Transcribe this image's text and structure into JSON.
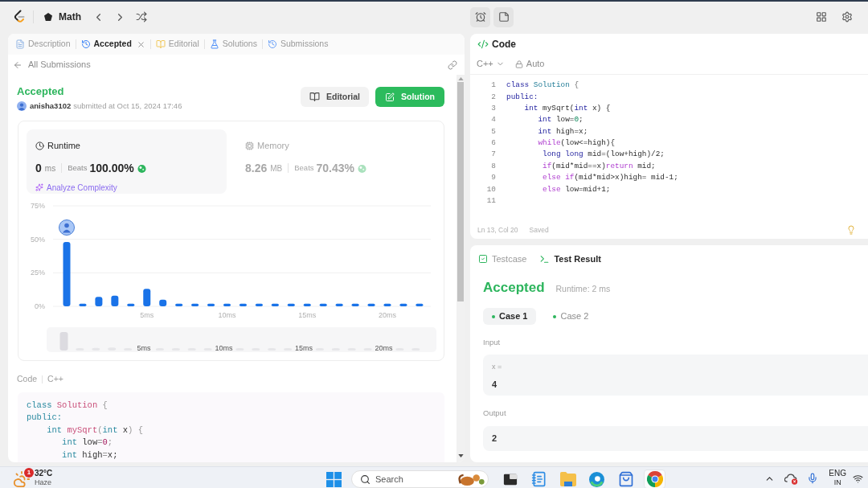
{
  "topbar": {
    "problem_list": "Math"
  },
  "left_panel": {
    "tabs": [
      {
        "label": "Description",
        "kind": "description",
        "selected": false,
        "closable": false
      },
      {
        "label": "Accepted",
        "kind": "accepted",
        "selected": true,
        "closable": true
      },
      {
        "label": "Editorial",
        "kind": "editorial",
        "selected": false,
        "closable": false
      },
      {
        "label": "Solutions",
        "kind": "solutions",
        "selected": false,
        "closable": false
      },
      {
        "label": "Submissions",
        "kind": "submissions",
        "selected": false,
        "closable": false
      }
    ],
    "back_link": "All Submissions",
    "submission": {
      "status": "Accepted",
      "user": "anisha3102",
      "submitted": "submitted at Oct 15, 2024 17:46"
    },
    "buttons": [
      {
        "label": "Editorial",
        "kind": "secondary"
      },
      {
        "label": "Solution",
        "kind": "primary"
      }
    ],
    "metrics": [
      {
        "kind": "runtime",
        "label": "Runtime",
        "value": "0",
        "unit": "ms",
        "beats_label": "Beats",
        "beats": "100.00%",
        "selected": true,
        "link": "Analyze Complexity"
      },
      {
        "kind": "memory",
        "label": "Memory",
        "value": "8.26",
        "unit": "MB",
        "beats_label": "Beats",
        "beats": "70.43%",
        "selected": false
      }
    ],
    "chart_data": {
      "type": "bar",
      "categories": [
        null,
        null,
        null,
        null,
        null,
        "5ms",
        null,
        null,
        null,
        null,
        "10ms",
        null,
        null,
        null,
        null,
        "15ms",
        null,
        null,
        null,
        null,
        "20ms",
        null,
        null
      ],
      "values": [
        48,
        2,
        7,
        8,
        2,
        13,
        5,
        2,
        2,
        2,
        2,
        2,
        2,
        2,
        2,
        2,
        2,
        2,
        2,
        2,
        2,
        2,
        2
      ],
      "ylim": [
        0,
        75
      ],
      "yticks": [
        {
          "value": 0,
          "label": "0%"
        },
        {
          "value": 25,
          "label": "25%"
        },
        {
          "value": 50,
          "label": "50%"
        },
        {
          "value": 75,
          "label": "75%"
        }
      ]
    },
    "overview_labels": [
      "5ms",
      "10ms",
      "15ms",
      "20ms"
    ],
    "code_header": {
      "title": "Code",
      "language": "C++"
    },
    "code": [
      {
        "tokens": [
          {
            "text": "class",
            "kind": "keyword"
          },
          {
            "text": " Solution",
            "kind": "type"
          },
          {
            "text": " {",
            "kind": "punct"
          }
        ]
      },
      {
        "tokens": [
          {
            "text": "public:",
            "kind": "keyword"
          }
        ]
      },
      {
        "tokens": [
          {
            "text": "    int",
            "kind": "keyword"
          },
          {
            "text": " mySqrt",
            "kind": "type"
          },
          {
            "text": "(",
            "kind": "punct"
          },
          {
            "text": "int",
            "kind": "keyword"
          },
          {
            "text": " x",
            "kind": "plain"
          },
          {
            "text": ") {",
            "kind": "punct"
          }
        ]
      },
      {
        "tokens": [
          {
            "text": "       int",
            "kind": "keyword"
          },
          {
            "text": " low",
            "kind": "plain"
          },
          {
            "text": "=",
            "kind": "punct"
          },
          {
            "text": "0",
            "kind": "number"
          },
          {
            "text": ";",
            "kind": "punct"
          }
        ]
      },
      {
        "tokens": [
          {
            "text": "       int",
            "kind": "keyword"
          },
          {
            "text": " high",
            "kind": "plain"
          },
          {
            "text": "=",
            "kind": "punct"
          },
          {
            "text": "x;",
            "kind": "plain"
          }
        ]
      }
    ]
  },
  "editor": {
    "title": "Code",
    "language": "C++",
    "mode": "Auto",
    "lines": [
      {
        "number": "1",
        "tokens": [
          {
            "text": "class",
            "kind": "keyword"
          },
          {
            "text": " Solution",
            "kind": "type"
          },
          {
            "text": " {",
            "kind": "punct"
          }
        ]
      },
      {
        "number": "2",
        "tokens": [
          {
            "text": "public:",
            "kind": "keyword"
          }
        ]
      },
      {
        "number": "3",
        "tokens": [
          {
            "text": "    int",
            "kind": "keyword"
          },
          {
            "text": " mySqrt(",
            "kind": "plain"
          },
          {
            "text": "int",
            "kind": "keyword"
          },
          {
            "text": " x) {",
            "kind": "plain"
          }
        ]
      },
      {
        "number": "4",
        "tokens": [
          {
            "text": "       int",
            "kind": "keyword"
          },
          {
            "text": " low=",
            "kind": "plain"
          },
          {
            "text": "0",
            "kind": "number"
          },
          {
            "text": ";",
            "kind": "plain"
          }
        ]
      },
      {
        "number": "5",
        "tokens": [
          {
            "text": "       int",
            "kind": "keyword"
          },
          {
            "text": " high=x;",
            "kind": "plain"
          }
        ]
      },
      {
        "number": "6",
        "tokens": [
          {
            "text": "       while",
            "kind": "control"
          },
          {
            "text": "(low<=high){",
            "kind": "plain"
          }
        ]
      },
      {
        "number": "7",
        "tokens": [
          {
            "text": "        long long",
            "kind": "keyword"
          },
          {
            "text": " mid=(low+high)/2;",
            "kind": "plain"
          }
        ]
      },
      {
        "number": "8",
        "tokens": [
          {
            "text": "        if",
            "kind": "control"
          },
          {
            "text": "(mid*mid==x)",
            "kind": "plain"
          },
          {
            "text": "return",
            "kind": "control"
          },
          {
            "text": " mid;",
            "kind": "plain"
          }
        ]
      },
      {
        "number": "9",
        "tokens": [
          {
            "text": "        else if",
            "kind": "control"
          },
          {
            "text": "(mid*mid>x)high= mid-1;",
            "kind": "plain"
          }
        ]
      },
      {
        "number": "10",
        "tokens": [
          {
            "text": "        else",
            "kind": "control"
          },
          {
            "text": " low=mid+1;",
            "kind": "plain"
          }
        ]
      },
      {
        "number": "11"
      }
    ],
    "status": {
      "position": "Ln 13, Col 20",
      "saved": "Saved"
    }
  },
  "result": {
    "tabs": [
      {
        "label": "Testcase",
        "kind": "testcase",
        "selected": false
      },
      {
        "label": "Test Result",
        "kind": "result",
        "selected": true
      }
    ],
    "verdict": "Accepted",
    "runtime": "Runtime: 2 ms",
    "cases": [
      {
        "label": "Case 1",
        "selected": true,
        "passed": true
      },
      {
        "label": "Case 2",
        "selected": false,
        "passed": true
      }
    ],
    "input_label": "Input",
    "inputs": [
      {
        "name": "x =",
        "value": "4"
      }
    ],
    "output_label": "Output",
    "output": "2"
  },
  "taskbar": {
    "weather": {
      "badge": "1",
      "temperature": "32°C",
      "condition": "Haze"
    },
    "search": {
      "label": "Search"
    },
    "apps": [
      {
        "kind": "terminal",
        "selected": false
      },
      {
        "kind": "notepad",
        "selected": false
      },
      {
        "kind": "files",
        "selected": false
      },
      {
        "kind": "edge",
        "selected": false
      },
      {
        "kind": "store",
        "selected": false
      },
      {
        "kind": "chrome",
        "selected": true
      }
    ],
    "language": {
      "code": "ENG",
      "region": "IN"
    }
  }
}
